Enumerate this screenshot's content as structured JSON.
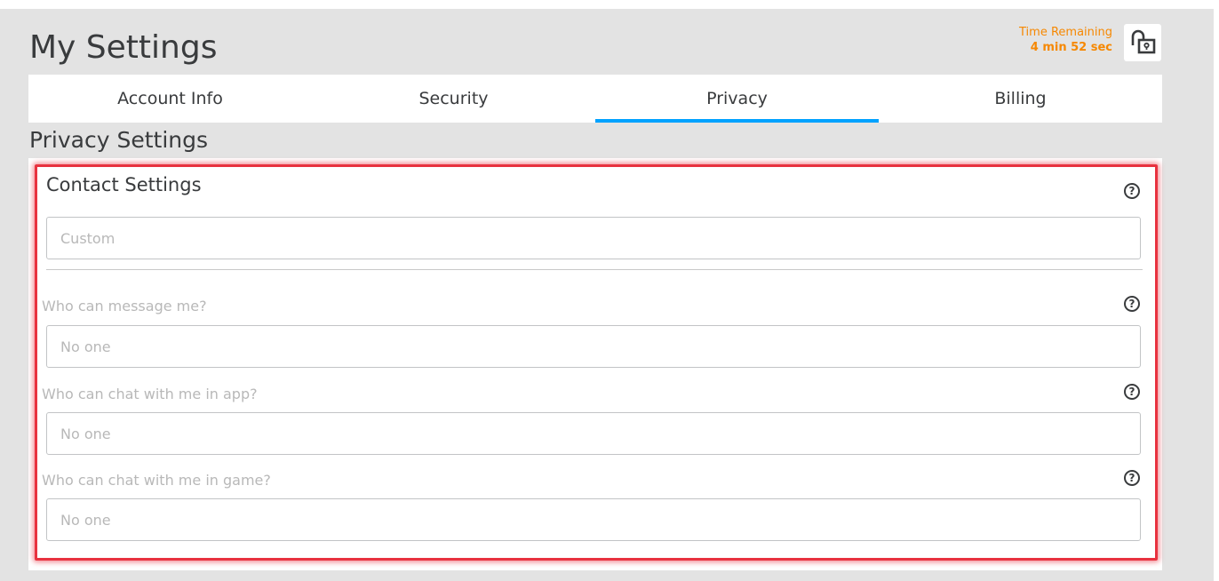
{
  "header": {
    "title": "My Settings",
    "timer_label": "Time Remaining",
    "timer_value": "4 min 52 sec",
    "lock_icon": "unlocked-padlock-icon"
  },
  "tabs": [
    {
      "label": "Account Info",
      "active": false
    },
    {
      "label": "Security",
      "active": false
    },
    {
      "label": "Privacy",
      "active": true
    },
    {
      "label": "Billing",
      "active": false
    }
  ],
  "section": {
    "title": "Privacy Settings"
  },
  "contact": {
    "title": "Contact Settings",
    "help_icon": "?",
    "preset_value": "Custom",
    "questions": [
      {
        "label": "Who can message me?",
        "value": "No one"
      },
      {
        "label": "Who can chat with me in app?",
        "value": "No one"
      },
      {
        "label": "Who can chat with me in game?",
        "value": "No one"
      }
    ]
  },
  "colors": {
    "accent": "#00a2ff",
    "timer": "#f68802",
    "highlight": "#e8323f",
    "background": "#e3e3e3"
  }
}
